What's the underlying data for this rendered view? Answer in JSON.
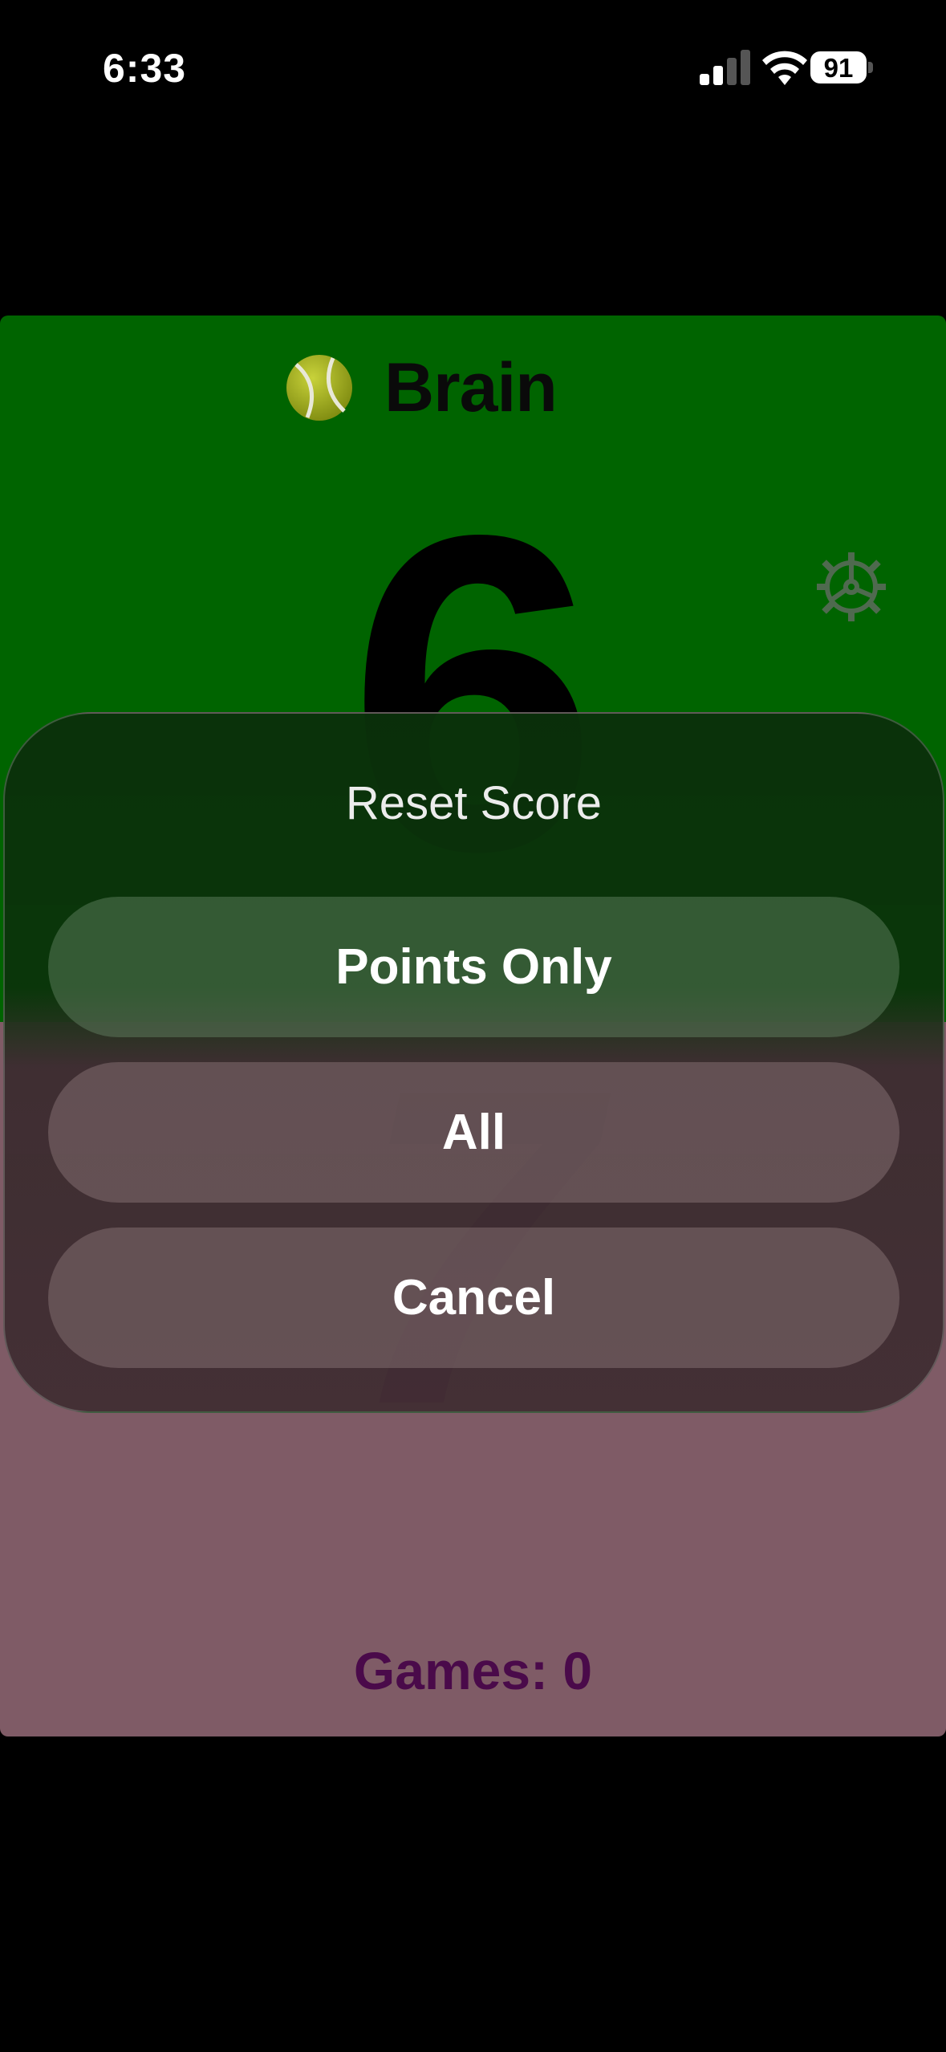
{
  "status_bar": {
    "time": "6:33",
    "battery": "91",
    "icons": [
      "signal-icon",
      "wifi-icon",
      "battery-icon"
    ]
  },
  "team": {
    "name": "Brain",
    "icon": "tennis-ball-icon"
  },
  "scores": {
    "top": "6",
    "bottom": "7",
    "games_label": "Games: 0"
  },
  "settings": {
    "icon": "gear-icon"
  },
  "sheet": {
    "title": "Reset Score",
    "points_only_label": "Points Only",
    "all_label": "All",
    "cancel_label": "Cancel"
  },
  "colors": {
    "top_team": "#006400",
    "bottom_team": "#7f5b66",
    "bottom_text": "#4a0a4a"
  }
}
